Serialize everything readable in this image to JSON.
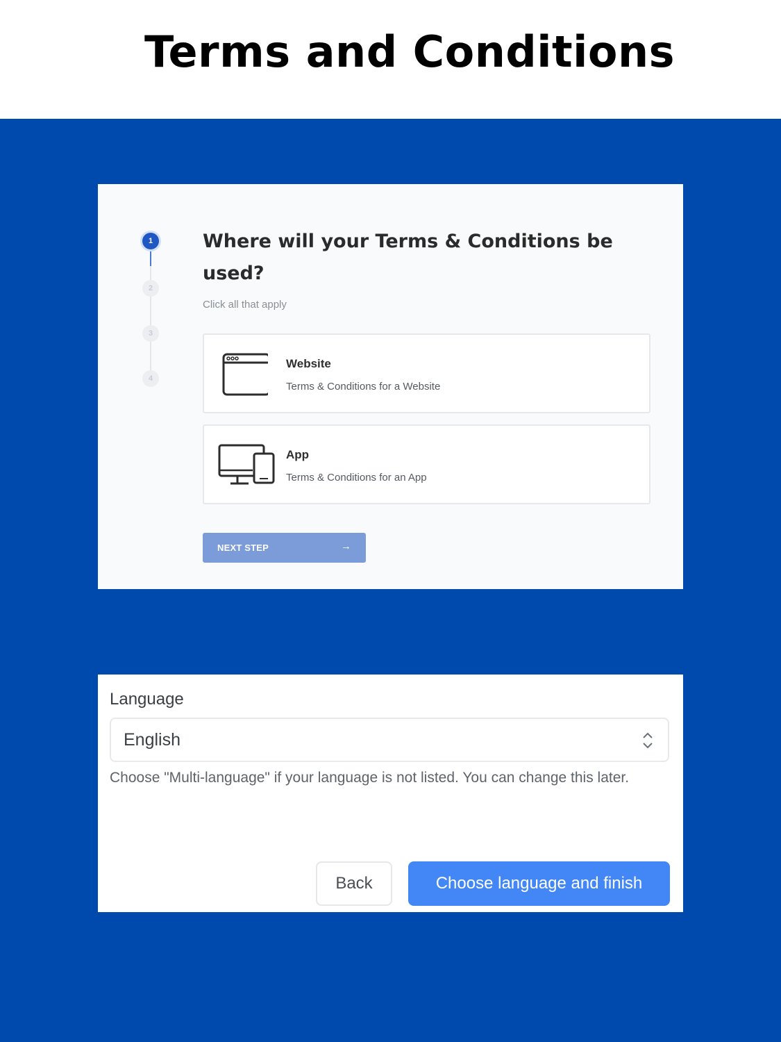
{
  "page": {
    "title": "Terms and Conditions"
  },
  "wizard": {
    "steps": [
      {
        "number": "1",
        "state": "active"
      },
      {
        "number": "2",
        "state": "inactive"
      },
      {
        "number": "3",
        "state": "inactive"
      },
      {
        "number": "4",
        "state": "inactive"
      }
    ],
    "question": "Where will your Terms & Conditions be used?",
    "subtitle": "Click all that apply",
    "options": [
      {
        "icon": "browser-window-icon",
        "title": "Website",
        "description": "Terms & Conditions for a Website"
      },
      {
        "icon": "devices-icon",
        "title": "App",
        "description": "Terms & Conditions for an App"
      }
    ],
    "next_label": "NEXT STEP",
    "next_arrow": "→"
  },
  "language_form": {
    "label": "Language",
    "selected": "English",
    "help": "Choose \"Multi-language\" if your language is not listed. You can change this later.",
    "back_label": "Back",
    "finish_label": "Choose language and finish"
  },
  "colors": {
    "panel_blue": "#004aad",
    "step_active": "#1f57c3",
    "next_button": "#7b9cd8",
    "finish_button": "#4287f5"
  }
}
